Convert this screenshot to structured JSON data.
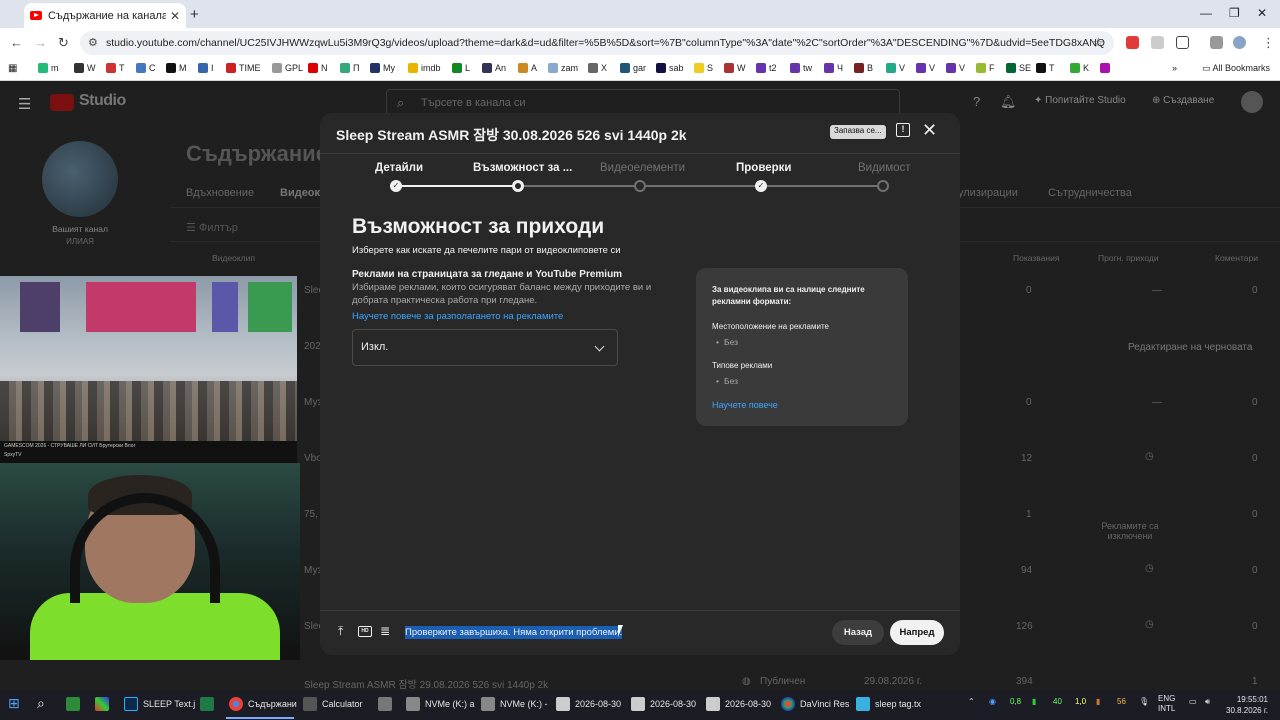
{
  "browser": {
    "tab_title": "Съдържание на канала - YouTube",
    "url": "studio.youtube.com/channel/UC25IVJHWWzqwLu5i3M9rQ3g/videos/upload?theme=dark&d=ud&filter=%5B%5D&sort=%7B\"columnType\"%3A\"date\"%2C\"sortOrder\"%3A\"DESCENDING\"%7D&udvid=5eeTDG8xANQ",
    "bookmarks": [
      "m",
      "W",
      "T",
      "C",
      "M",
      "I",
      "TIME",
      "GPL",
      "N",
      "П",
      "My",
      "imdb",
      "L",
      "An",
      "A",
      "zam",
      "X",
      "gar",
      "sab",
      "S",
      "W",
      "t2",
      "tw",
      "Ч",
      "B",
      "V",
      "V",
      "V",
      "F",
      "SE",
      "T",
      "K"
    ],
    "all_bookmarks": "All Bookmarks"
  },
  "studio": {
    "logo_text": "Studio",
    "search_placeholder": "Търсете в канала си",
    "try_studio": "Попитайте Studio",
    "create": "Създаване",
    "channel_label": "Вашият канал",
    "channel_name": "ИЛИАЯ",
    "page_title": "Съдържание",
    "tabs": [
      "Вдъхновение",
      "Видеокл",
      "улизирации",
      "Сътрудничества"
    ],
    "filter": "Филтър",
    "columns": {
      "video": "Видеоклип",
      "views": "Показвания",
      "revenue": "Прогн. приходи",
      "comments": "Коментари"
    },
    "rows": [
      {
        "title": "Slee",
        "sub": "Fat",
        "views": "0",
        "revenue": "—",
        "comments": "0"
      },
      {
        "title": "2026",
        "sub": "Sasc",
        "views": "",
        "revenue": "",
        "comments": ""
      },
      {
        "title": "Муз",
        "sub": "Fat",
        "views": "0",
        "revenue": "—",
        "comments": "0"
      },
      {
        "title": "Vbo",
        "sub": "",
        "views": "12",
        "revenue": "",
        "comments": "0"
      },
      {
        "title": "75,",
        "sub": "Fat",
        "views": "1",
        "revenue": "Рекламите са изключени",
        "comments": "0"
      },
      {
        "title": "Муз",
        "sub": "SPV",
        "views": "94",
        "revenue": "",
        "comments": "0"
      },
      {
        "title": "Slee",
        "sub": "Fat",
        "views": "126",
        "revenue": "",
        "comments": "0"
      }
    ],
    "draft_button": "Редактиране на черновата",
    "bottom_row": {
      "title": "Sleep Stream ASMR 잠방 29.08.2026 526 svi 1440p 2k",
      "visibility": "Публичен",
      "date": "29.08.2026 г.",
      "views": "394",
      "comments": "1"
    }
  },
  "stream_overlay": {
    "caption": "GAMESCOM 2026 - СТРУВАШЕ ЛИ СИТ Брутерски Влог",
    "channel": "SpxyTV"
  },
  "modal": {
    "title": "Sleep Stream ASMR 잠방 30.08.2026 526 svi 1440p 2k",
    "saving": "Запазва се...",
    "steps": [
      {
        "label": "Детайли",
        "state": "done"
      },
      {
        "label": "Възможност за ...",
        "state": "current"
      },
      {
        "label": "Видеоелементи",
        "state": "todo"
      },
      {
        "label": "Проверки",
        "state": "done"
      },
      {
        "label": "Видимост",
        "state": "todo"
      }
    ],
    "heading": "Възможност за приходи",
    "subheading": "Изберете как искате да печелите пари от видеоклиповете си",
    "ads_title": "Реклами на страницата за гледане и YouTube Premium",
    "ads_description": "Избираме реклами, които осигуряват баланс между приходите ви и добрата практическа работа при гледане.",
    "ads_link": "Научете повече за разполагането на рекламите",
    "select_value": "Изкл.",
    "info": {
      "heading": "За видеоклипа ви са налице следните рекламни формати:",
      "placement_label": "Местоположение на рекламите",
      "placement_value": "Без",
      "types_label": "Типове реклами",
      "types_value": "Без",
      "link": "Научете повече"
    },
    "status": "Проверките завършиха. Няма открити проблеми.",
    "back": "Назад",
    "next": "Напред"
  },
  "taskbar": {
    "items": [
      "SLEEP Text.j",
      "Съдържани",
      "Calculator",
      "NVMe (K:) a",
      "NVMe (K:) -",
      "2026-08-30",
      "2026-08-30",
      "2026-08-30",
      "DaVinci Res",
      "sleep tag.tx"
    ],
    "tray_values": [
      "0,8",
      "40",
      "1,0",
      "56"
    ],
    "language": "ENG",
    "layout": "INTL",
    "time": "19:55:01",
    "date": "30.8.2026 г."
  },
  "colors": {
    "accent_link": "#3ea6ff",
    "modal_bg": "#282828",
    "page_bg": "#1f1f1f",
    "selection": "#1a5fb4"
  }
}
